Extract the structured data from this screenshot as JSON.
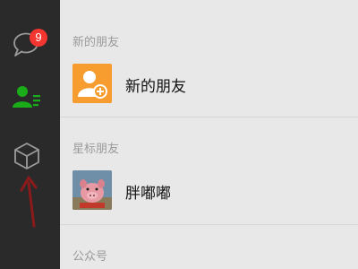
{
  "nav": {
    "chat_badge": "9",
    "icons": [
      "chat-bubble-icon",
      "contacts-icon",
      "cube-icon"
    ],
    "active_color": "#1aad19",
    "badge_color": "#f43530",
    "annotation_arrow_color": "#8b1a1a"
  },
  "contacts": {
    "sections": [
      {
        "header": "新的朋友",
        "item": "新的朋友",
        "avatar": "add-friend-icon",
        "avatar_color": "#f79c2e"
      },
      {
        "header": "星标朋友",
        "item": "胖嘟嘟",
        "avatar": "pig-avatar"
      },
      {
        "header": "公众号"
      }
    ]
  }
}
